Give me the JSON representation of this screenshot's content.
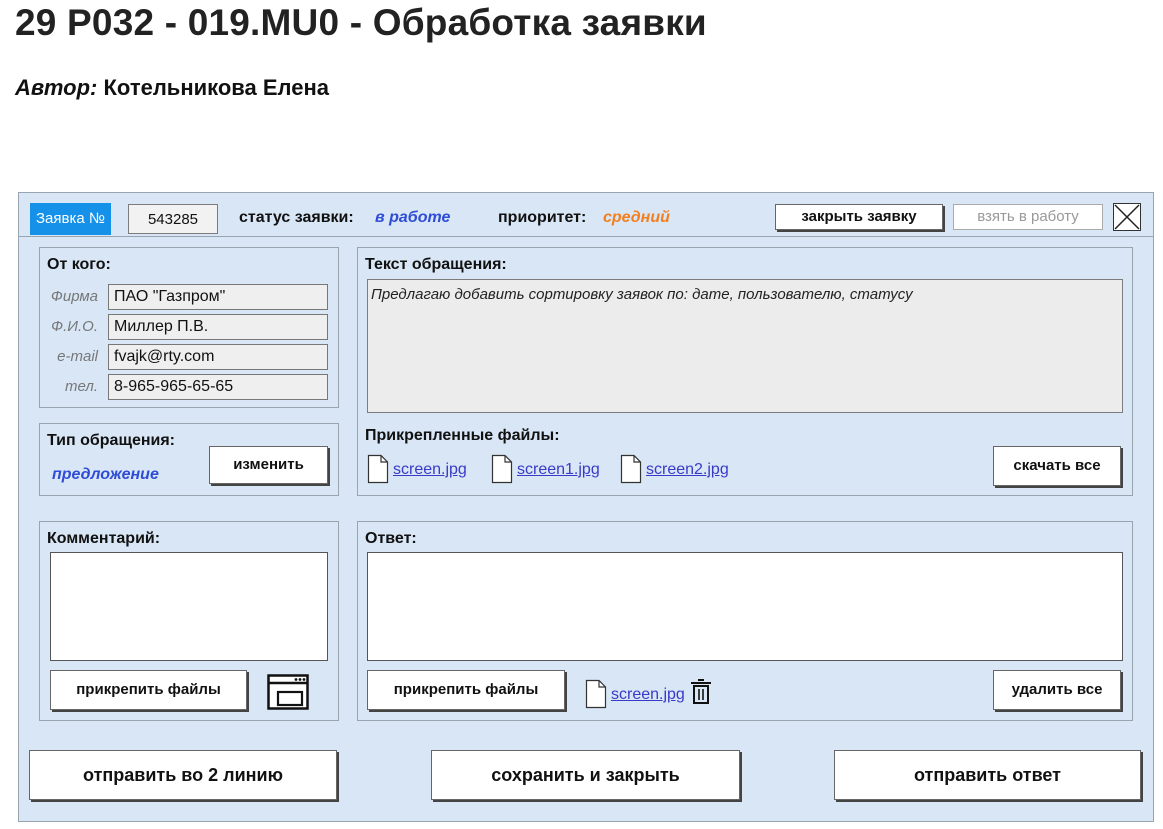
{
  "page": {
    "title": "29 P032 - 019.MU0 - Обработка заявки",
    "author_label": "Автор:",
    "author_name": "Котельникова Елена"
  },
  "header": {
    "request_label": "Заявка №",
    "request_number": "543285",
    "status_label": "статус заявки:",
    "status_value": "в работе",
    "priority_label": "приоритет:",
    "priority_value": "средний",
    "close_request_label": "закрыть заявку",
    "take_to_work_label": "взять в работу",
    "colors": {
      "status": "#2f4cd6",
      "priority": "#f28020",
      "request_badge": "#1691ea"
    }
  },
  "from": {
    "title": "От кого:",
    "fields": [
      {
        "label": "Фирма",
        "value": "ПАО \"Газпром\""
      },
      {
        "label": "Ф.И.О.",
        "value": "Миллер П.В."
      },
      {
        "label": "e-mail",
        "value": "fvajk@rty.com"
      },
      {
        "label": "тел.",
        "value": "8-965-965-65-65"
      }
    ]
  },
  "request_type": {
    "title": "Тип обращения:",
    "value": "предложение",
    "change_label": "изменить"
  },
  "message": {
    "title": "Текст обращения:",
    "text": "Предлагаю добавить сортировку заявок по: дате, пользователю, статусу",
    "attachments_title": "Прикрепленные файлы:",
    "files": [
      "screen.jpg",
      "screen1.jpg",
      "screen2.jpg"
    ],
    "download_all_label": "скачать все"
  },
  "comment": {
    "title": "Комментарий:",
    "attach_label": "прикрепить файлы",
    "icon": "window-icon"
  },
  "answer": {
    "title": "Ответ:",
    "attach_label": "прикрепить файлы",
    "file": "screen.jpg",
    "delete_all_label": "удалить все",
    "icon": "trash-icon"
  },
  "footer": {
    "send_second_line_label": "отправить во 2 линию",
    "save_close_label": "сохранить и закрыть",
    "send_answer_label": "отправить ответ"
  }
}
